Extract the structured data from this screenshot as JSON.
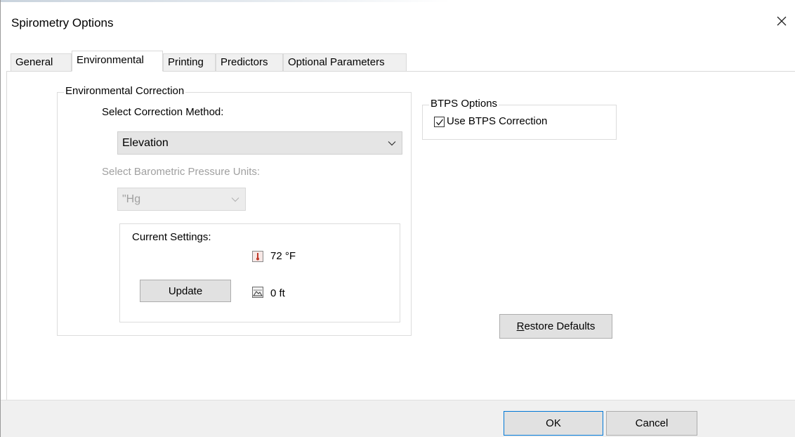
{
  "window": {
    "title": "Spirometry Options"
  },
  "tabs": [
    {
      "label": "General",
      "active": false
    },
    {
      "label": "Environmental",
      "active": true
    },
    {
      "label": "Printing",
      "active": false
    },
    {
      "label": "Predictors",
      "active": false
    },
    {
      "label": "Optional Parameters",
      "active": false
    }
  ],
  "environmental_correction": {
    "group_label": "Environmental Correction",
    "method_label": "Select Correction Method:",
    "method_value": "Elevation",
    "pressure_label": "Select Barometric Pressure Units:",
    "pressure_value": "\"Hg",
    "pressure_enabled": false,
    "current_settings": {
      "label": "Current Settings:",
      "temperature": "72 °F",
      "elevation": "0 ft",
      "update_label": "Update",
      "thermometer_icon": "thermometer-icon",
      "elevation_icon": "mountain-icon"
    }
  },
  "btps": {
    "group_label": "BTPS Options",
    "checkbox_label": "Use BTPS Correction",
    "checked": true
  },
  "restore_defaults": {
    "label_accel": "R",
    "label_rest": "estore Defaults"
  },
  "footer": {
    "ok_label": "OK",
    "cancel_label": "Cancel"
  },
  "colors": {
    "default_button_border": "#0078d7",
    "disabled_text": "#a0a0a0",
    "thermometer_red": "#c0392b"
  }
}
